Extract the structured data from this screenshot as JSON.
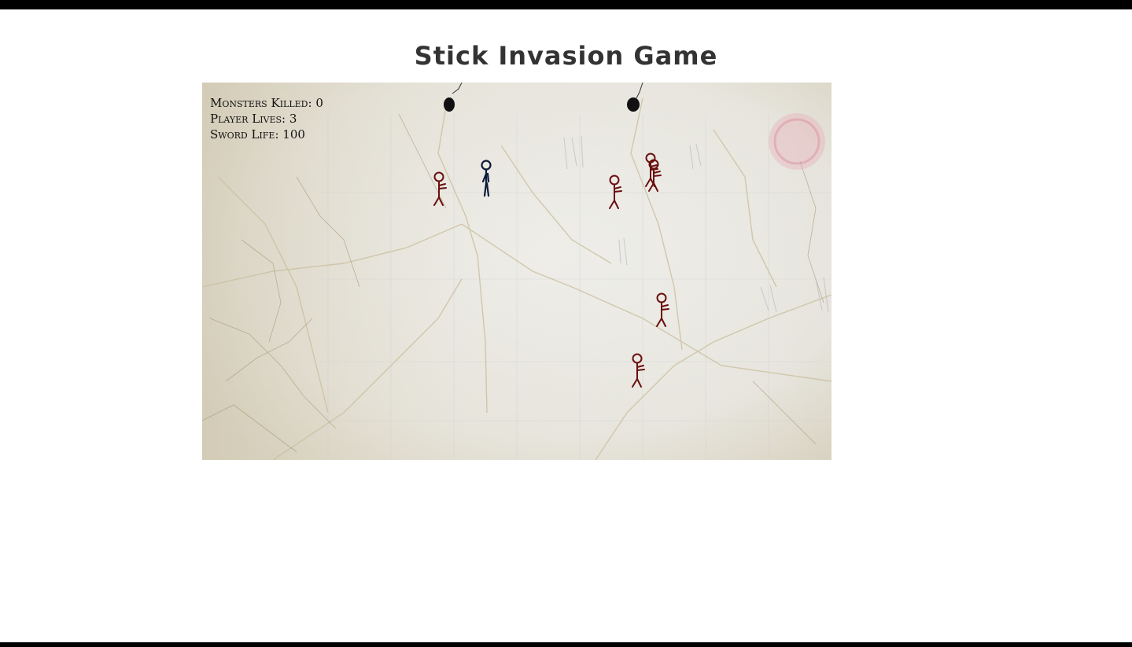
{
  "page": {
    "title": "Stick Invasion Game"
  },
  "hud": {
    "monsters_killed_label": "Monsters Killed:",
    "monsters_killed": "0",
    "player_lives_label": "Player Lives:",
    "player_lives": "3",
    "sword_life_label": "Sword Life:",
    "sword_life": "100"
  },
  "colors": {
    "monster": "#6b0f0f",
    "player": "#0e1a3a",
    "paper": "#e9e8e3",
    "bars": "#000000",
    "title": "#333333"
  }
}
